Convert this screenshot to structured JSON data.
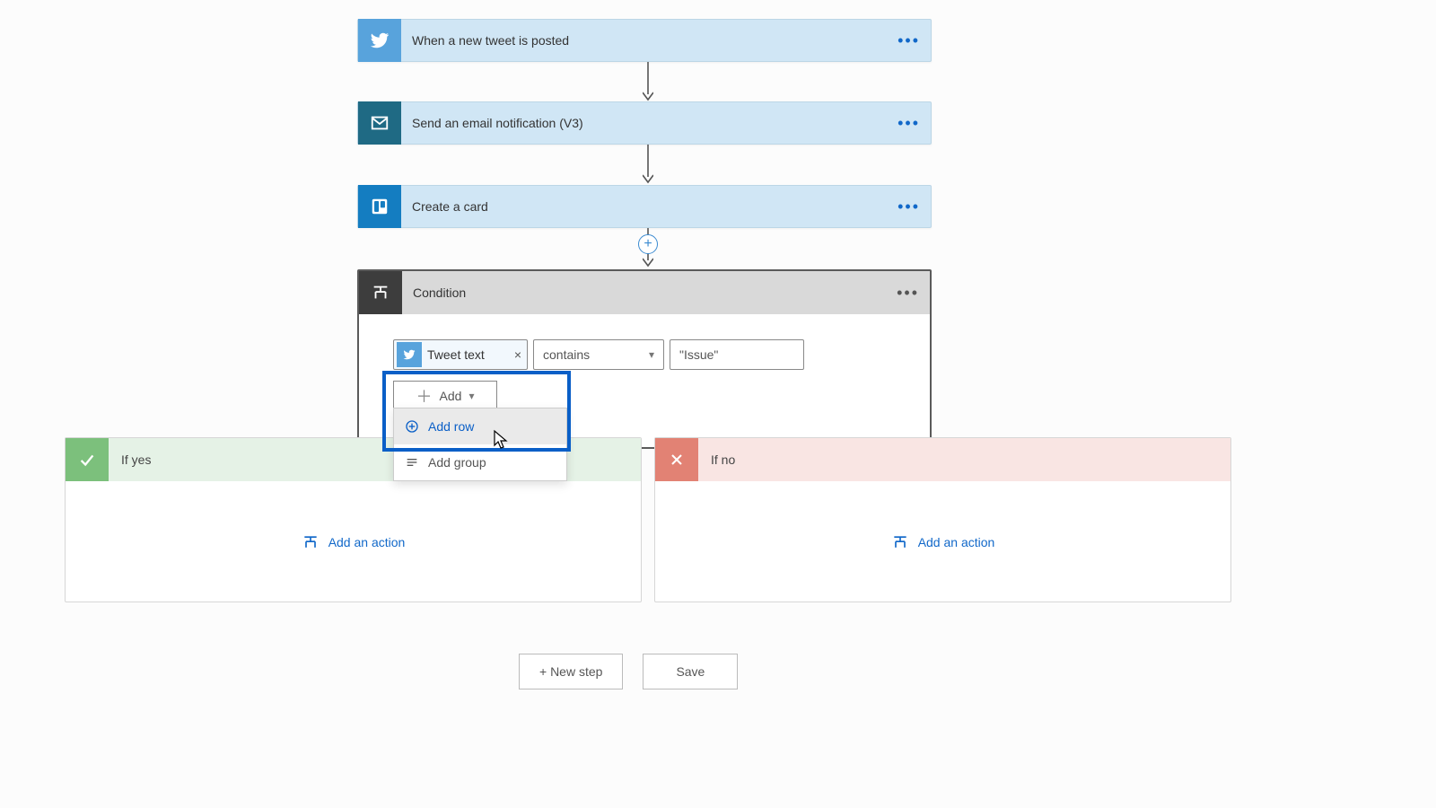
{
  "steps": [
    {
      "label": "When a new tweet is posted"
    },
    {
      "label": "Send an email notification (V3)"
    },
    {
      "label": "Create a card"
    }
  ],
  "condition": {
    "title": "Condition",
    "pill_label": "Tweet text",
    "operator": "contains",
    "value": "\"Issue\"",
    "add_label": "Add"
  },
  "dropdown": {
    "row": "Add row",
    "group": "Add group"
  },
  "branches": {
    "yes": {
      "title": "If yes",
      "action": "Add an action"
    },
    "no": {
      "title": "If no",
      "action": "Add an action"
    }
  },
  "footer": {
    "new_step": "+ New step",
    "save": "Save"
  }
}
